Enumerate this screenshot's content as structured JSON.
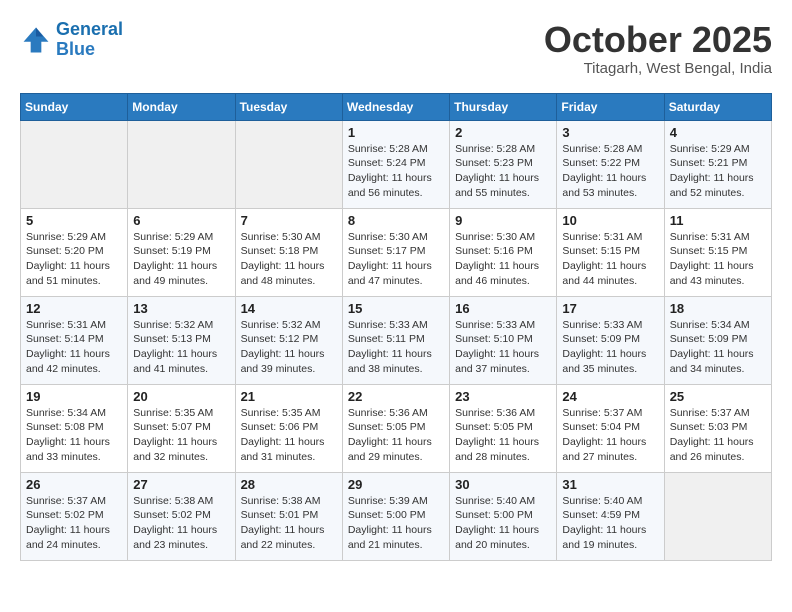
{
  "header": {
    "logo_line1": "General",
    "logo_line2": "Blue",
    "month_title": "October 2025",
    "location": "Titagarh, West Bengal, India"
  },
  "columns": [
    "Sunday",
    "Monday",
    "Tuesday",
    "Wednesday",
    "Thursday",
    "Friday",
    "Saturday"
  ],
  "weeks": [
    [
      {
        "day": "",
        "sunrise": "",
        "sunset": "",
        "daylight": ""
      },
      {
        "day": "",
        "sunrise": "",
        "sunset": "",
        "daylight": ""
      },
      {
        "day": "",
        "sunrise": "",
        "sunset": "",
        "daylight": ""
      },
      {
        "day": "1",
        "sunrise": "Sunrise: 5:28 AM",
        "sunset": "Sunset: 5:24 PM",
        "daylight": "Daylight: 11 hours and 56 minutes."
      },
      {
        "day": "2",
        "sunrise": "Sunrise: 5:28 AM",
        "sunset": "Sunset: 5:23 PM",
        "daylight": "Daylight: 11 hours and 55 minutes."
      },
      {
        "day": "3",
        "sunrise": "Sunrise: 5:28 AM",
        "sunset": "Sunset: 5:22 PM",
        "daylight": "Daylight: 11 hours and 53 minutes."
      },
      {
        "day": "4",
        "sunrise": "Sunrise: 5:29 AM",
        "sunset": "Sunset: 5:21 PM",
        "daylight": "Daylight: 11 hours and 52 minutes."
      }
    ],
    [
      {
        "day": "5",
        "sunrise": "Sunrise: 5:29 AM",
        "sunset": "Sunset: 5:20 PM",
        "daylight": "Daylight: 11 hours and 51 minutes."
      },
      {
        "day": "6",
        "sunrise": "Sunrise: 5:29 AM",
        "sunset": "Sunset: 5:19 PM",
        "daylight": "Daylight: 11 hours and 49 minutes."
      },
      {
        "day": "7",
        "sunrise": "Sunrise: 5:30 AM",
        "sunset": "Sunset: 5:18 PM",
        "daylight": "Daylight: 11 hours and 48 minutes."
      },
      {
        "day": "8",
        "sunrise": "Sunrise: 5:30 AM",
        "sunset": "Sunset: 5:17 PM",
        "daylight": "Daylight: 11 hours and 47 minutes."
      },
      {
        "day": "9",
        "sunrise": "Sunrise: 5:30 AM",
        "sunset": "Sunset: 5:16 PM",
        "daylight": "Daylight: 11 hours and 46 minutes."
      },
      {
        "day": "10",
        "sunrise": "Sunrise: 5:31 AM",
        "sunset": "Sunset: 5:15 PM",
        "daylight": "Daylight: 11 hours and 44 minutes."
      },
      {
        "day": "11",
        "sunrise": "Sunrise: 5:31 AM",
        "sunset": "Sunset: 5:15 PM",
        "daylight": "Daylight: 11 hours and 43 minutes."
      }
    ],
    [
      {
        "day": "12",
        "sunrise": "Sunrise: 5:31 AM",
        "sunset": "Sunset: 5:14 PM",
        "daylight": "Daylight: 11 hours and 42 minutes."
      },
      {
        "day": "13",
        "sunrise": "Sunrise: 5:32 AM",
        "sunset": "Sunset: 5:13 PM",
        "daylight": "Daylight: 11 hours and 41 minutes."
      },
      {
        "day": "14",
        "sunrise": "Sunrise: 5:32 AM",
        "sunset": "Sunset: 5:12 PM",
        "daylight": "Daylight: 11 hours and 39 minutes."
      },
      {
        "day": "15",
        "sunrise": "Sunrise: 5:33 AM",
        "sunset": "Sunset: 5:11 PM",
        "daylight": "Daylight: 11 hours and 38 minutes."
      },
      {
        "day": "16",
        "sunrise": "Sunrise: 5:33 AM",
        "sunset": "Sunset: 5:10 PM",
        "daylight": "Daylight: 11 hours and 37 minutes."
      },
      {
        "day": "17",
        "sunrise": "Sunrise: 5:33 AM",
        "sunset": "Sunset: 5:09 PM",
        "daylight": "Daylight: 11 hours and 35 minutes."
      },
      {
        "day": "18",
        "sunrise": "Sunrise: 5:34 AM",
        "sunset": "Sunset: 5:09 PM",
        "daylight": "Daylight: 11 hours and 34 minutes."
      }
    ],
    [
      {
        "day": "19",
        "sunrise": "Sunrise: 5:34 AM",
        "sunset": "Sunset: 5:08 PM",
        "daylight": "Daylight: 11 hours and 33 minutes."
      },
      {
        "day": "20",
        "sunrise": "Sunrise: 5:35 AM",
        "sunset": "Sunset: 5:07 PM",
        "daylight": "Daylight: 11 hours and 32 minutes."
      },
      {
        "day": "21",
        "sunrise": "Sunrise: 5:35 AM",
        "sunset": "Sunset: 5:06 PM",
        "daylight": "Daylight: 11 hours and 31 minutes."
      },
      {
        "day": "22",
        "sunrise": "Sunrise: 5:36 AM",
        "sunset": "Sunset: 5:05 PM",
        "daylight": "Daylight: 11 hours and 29 minutes."
      },
      {
        "day": "23",
        "sunrise": "Sunrise: 5:36 AM",
        "sunset": "Sunset: 5:05 PM",
        "daylight": "Daylight: 11 hours and 28 minutes."
      },
      {
        "day": "24",
        "sunrise": "Sunrise: 5:37 AM",
        "sunset": "Sunset: 5:04 PM",
        "daylight": "Daylight: 11 hours and 27 minutes."
      },
      {
        "day": "25",
        "sunrise": "Sunrise: 5:37 AM",
        "sunset": "Sunset: 5:03 PM",
        "daylight": "Daylight: 11 hours and 26 minutes."
      }
    ],
    [
      {
        "day": "26",
        "sunrise": "Sunrise: 5:37 AM",
        "sunset": "Sunset: 5:02 PM",
        "daylight": "Daylight: 11 hours and 24 minutes."
      },
      {
        "day": "27",
        "sunrise": "Sunrise: 5:38 AM",
        "sunset": "Sunset: 5:02 PM",
        "daylight": "Daylight: 11 hours and 23 minutes."
      },
      {
        "day": "28",
        "sunrise": "Sunrise: 5:38 AM",
        "sunset": "Sunset: 5:01 PM",
        "daylight": "Daylight: 11 hours and 22 minutes."
      },
      {
        "day": "29",
        "sunrise": "Sunrise: 5:39 AM",
        "sunset": "Sunset: 5:00 PM",
        "daylight": "Daylight: 11 hours and 21 minutes."
      },
      {
        "day": "30",
        "sunrise": "Sunrise: 5:40 AM",
        "sunset": "Sunset: 5:00 PM",
        "daylight": "Daylight: 11 hours and 20 minutes."
      },
      {
        "day": "31",
        "sunrise": "Sunrise: 5:40 AM",
        "sunset": "Sunset: 4:59 PM",
        "daylight": "Daylight: 11 hours and 19 minutes."
      },
      {
        "day": "",
        "sunrise": "",
        "sunset": "",
        "daylight": ""
      }
    ]
  ]
}
